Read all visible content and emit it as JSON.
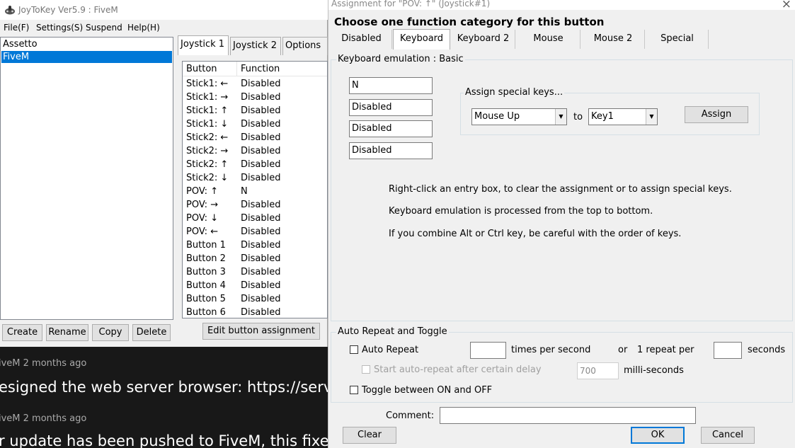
{
  "main_window": {
    "title": "JoyToKey Ver5.9 : FiveM",
    "menu": [
      "File(F)",
      "Settings(S)",
      "Suspend",
      "Help(H)"
    ],
    "profiles": [
      "Assetto",
      "FiveM"
    ],
    "selected_profile": "FiveM",
    "buttons": {
      "create": "Create",
      "rename": "Rename",
      "copy": "Copy",
      "delete": "Delete"
    },
    "tabs": [
      "Joystick 1",
      "Joystick 2",
      "Options"
    ],
    "table": {
      "headers": [
        "Button",
        "Function"
      ],
      "rows": [
        [
          "Stick1: ←",
          "Disabled"
        ],
        [
          "Stick1: →",
          "Disabled"
        ],
        [
          "Stick1: ↑",
          "Disabled"
        ],
        [
          "Stick1: ↓",
          "Disabled"
        ],
        [
          "Stick2: ←",
          "Disabled"
        ],
        [
          "Stick2: →",
          "Disabled"
        ],
        [
          "Stick2: ↑",
          "Disabled"
        ],
        [
          "Stick2: ↓",
          "Disabled"
        ],
        [
          "POV: ↑",
          "N"
        ],
        [
          "POV: →",
          "Disabled"
        ],
        [
          "POV: ↓",
          "Disabled"
        ],
        [
          "POV: ←",
          "Disabled"
        ],
        [
          "Button 1",
          "Disabled"
        ],
        [
          "Button 2",
          "Disabled"
        ],
        [
          "Button 3",
          "Disabled"
        ],
        [
          "Button 4",
          "Disabled"
        ],
        [
          "Button 5",
          "Disabled"
        ],
        [
          "Button 6",
          "Disabled"
        ]
      ]
    },
    "edit_button": "Edit button assignment"
  },
  "background": {
    "comments": [
      {
        "meta": "iveM 2 months ago",
        "text": "esigned the web server browser: https://servers.fi"
      },
      {
        "meta": "iveM 2 months ago",
        "text": "r update has been pushed to FiveM, this fixes play"
      }
    ]
  },
  "dialog": {
    "title": "Assignment for \"POV: ↑\" (Joystick#1)",
    "close_icon": "×",
    "heading": "Choose one function category for this button",
    "category_tabs": [
      "Disabled",
      "Keyboard",
      "Keyboard 2",
      "Mouse",
      "Mouse 2",
      "Special"
    ],
    "active_tab": "Keyboard",
    "keyboard_group": {
      "legend": "Keyboard emulation : Basic",
      "entries": [
        "N",
        "Disabled",
        "Disabled",
        "Disabled"
      ],
      "special_keys": {
        "legend": "Assign special keys...",
        "from": "Mouse Up",
        "to_label": "to",
        "to": "Key1",
        "assign": "Assign"
      },
      "info": [
        "Right-click an entry box, to clear the assignment or to assign special keys.",
        "Keyboard emulation is processed from the top to bottom.",
        "If you combine Alt or Ctrl key, be careful with the order of keys."
      ]
    },
    "auto_repeat": {
      "legend": "Auto Repeat and Toggle",
      "auto_repeat_label": "Auto Repeat",
      "times_value": "",
      "times_label": "times per second",
      "or_label": "or",
      "one_repeat_label": "1 repeat per",
      "seconds_value": "",
      "seconds_label": "seconds",
      "delay_label": "Start auto-repeat after certain delay",
      "delay_value": "700",
      "delay_unit": "milli-seconds",
      "toggle_label": "Toggle between ON and OFF"
    },
    "comment_label": "Comment:",
    "comment_value": "",
    "buttons": {
      "clear": "Clear",
      "ok": "OK",
      "cancel": "Cancel"
    }
  }
}
